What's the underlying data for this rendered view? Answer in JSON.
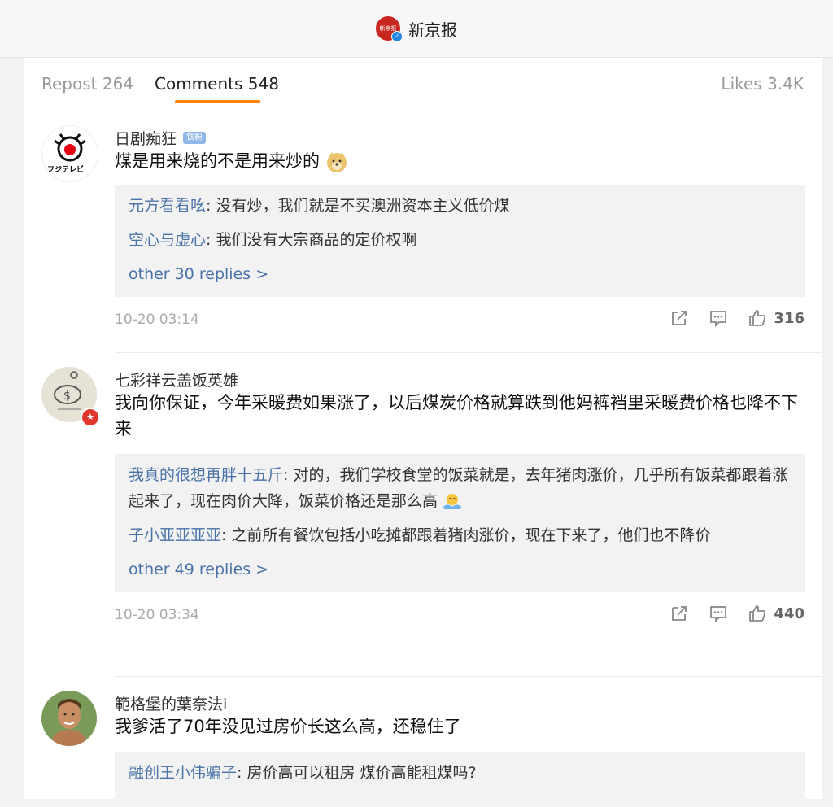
{
  "header": {
    "account_name": "新京报",
    "logo_text": "新京报"
  },
  "tabs": {
    "repost": "Repost 264",
    "comments": "Comments 548",
    "likes": "Likes 3.4K"
  },
  "comments": [
    {
      "user": "日剧痴狂",
      "badge": "铁粉",
      "avatar_text": "フジテレビ",
      "text": "煤是用来烧的不是用来炒的",
      "replies": [
        {
          "name": "元方看看吆",
          "text": ": 没有炒，我们就是不买澳洲资本主义低价煤"
        },
        {
          "name": "空心与虚心",
          "text": ": 我们没有大宗商品的定价权啊"
        }
      ],
      "more": "other 30 replies >",
      "time": "10-20 03:14",
      "likes": "316"
    },
    {
      "user": "七彩祥云盖饭英雄",
      "text": "我向你保证，今年采暖费如果涨了，以后煤炭价格就算跌到他妈裤裆里采暖费价格也降不下来",
      "replies": [
        {
          "name": "我真的很想再胖十五斤",
          "text": ": 对的，我们学校食堂的饭菜就是，去年猪肉涨价，几乎所有饭菜都跟着涨起来了，现在肉价大降，饭菜价格还是那么高"
        },
        {
          "name": "子小亚亚亚亚",
          "text": ": 之前所有餐饮包括小吃摊都跟着猪肉涨价，现在下来了，他们也不降价"
        }
      ],
      "more": "other 49 replies >",
      "time": "10-20 03:34",
      "likes": "440"
    },
    {
      "user": "範格堡的葉奈法i",
      "text": "我爹活了70年没见过房价长这么高，还稳住了",
      "replies": [
        {
          "name": "融创王小伟骗子",
          "text": ": 房价高可以租房 煤价高能租煤吗?"
        }
      ]
    }
  ],
  "colors": {
    "accent": "#ff8200",
    "link": "#4a72a8",
    "verified": "#1e88e5"
  }
}
